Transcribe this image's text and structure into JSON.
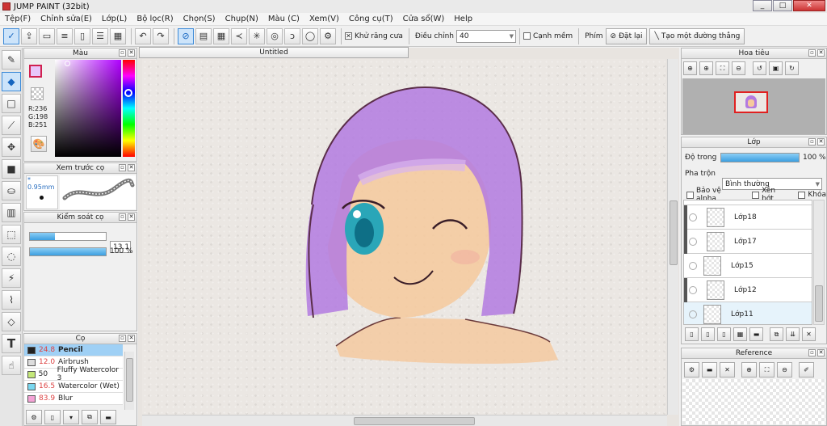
{
  "window": {
    "title": "JUMP PAINT (32bit)",
    "min": "_",
    "max": "□",
    "close": "✕"
  },
  "menu": [
    "Tệp(F)",
    "Chỉnh sửa(E)",
    "Lớp(L)",
    "Bộ lọc(R)",
    "Chọn(S)",
    "Chụp(N)",
    "Màu (C)",
    "Xem(V)",
    "Công cụ(T)",
    "Cửa sổ(W)",
    "Help"
  ],
  "toolbar": {
    "antialias_label": "Khử răng cưa",
    "adjust_label": "Điều chỉnh",
    "adjust_value": "40",
    "edge_label": "Cạnh mềm",
    "key_label": "Phím",
    "reset_label": "Đặt lại",
    "straight_label": "Tạo một đường thẳng"
  },
  "document": {
    "tab_title": "Untitled"
  },
  "color_panel": {
    "title": "Màu",
    "r": "R:236",
    "g": "G:198",
    "b": "B:251",
    "main_color": "#e8c6fa"
  },
  "brush_preview": {
    "title": "Xem trước cọ",
    "size": "0.95mm"
  },
  "brush_control": {
    "title": "Kiểm soát cọ",
    "size_value": "13.1",
    "density_fill": 0.33,
    "opacity_value": "100 %",
    "opacity_fill": 1.0
  },
  "brush_panel": {
    "title": "Cọ",
    "items": [
      {
        "size": "24.8",
        "name": "Pencil",
        "color": "#222222",
        "selected": true
      },
      {
        "size": "12.0",
        "name": "Airbrush",
        "color": "#dddddd"
      },
      {
        "size": "50",
        "name": "Fluffy Watercolor 3",
        "color": "#c5e87a"
      },
      {
        "size": "16.5",
        "name": "Watercolor (Wet)",
        "color": "#7ad8f0"
      },
      {
        "size": "83.9",
        "name": "Blur",
        "color": "#f5a3d6"
      }
    ]
  },
  "navigator": {
    "title": "Hoa tiêu"
  },
  "layer_panel": {
    "title": "Lớp",
    "opacity_label": "Độ trong",
    "opacity_value": "100 %",
    "blend_label": "Pha trộn",
    "blend_value": "Bình thường",
    "protect_alpha": "Bảo vệ alpha",
    "clip": "Xén bớt",
    "lock": "Khóa",
    "layers": [
      {
        "name": "Lớp18"
      },
      {
        "name": "Lớp17"
      },
      {
        "name": "Lớp15"
      },
      {
        "name": "Lớp12"
      },
      {
        "name": "Lớp11",
        "selected": true
      }
    ]
  },
  "reference": {
    "title": "Reference"
  }
}
